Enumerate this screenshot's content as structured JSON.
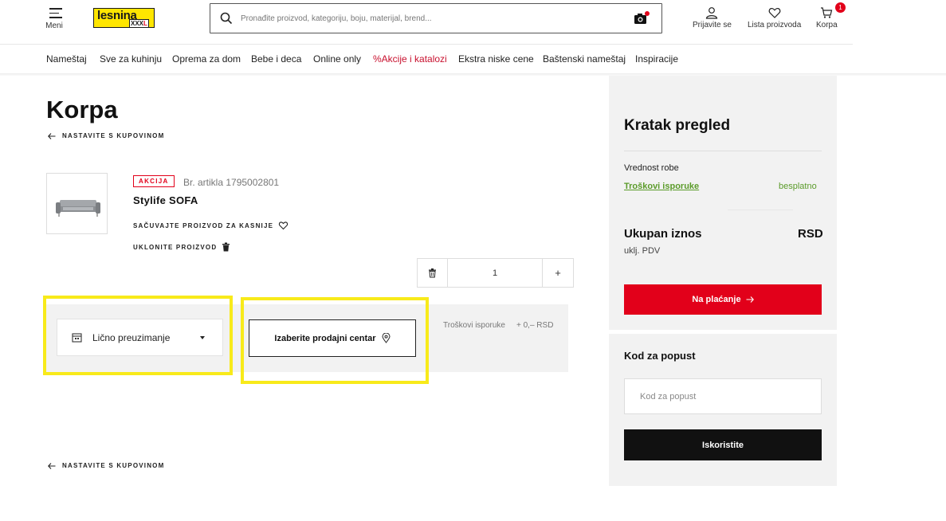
{
  "header": {
    "menu_label": "Meni",
    "logo_text": "lesnina",
    "logo_xxxl": "XXX",
    "logo_l": "L",
    "search_placeholder": "Pronađite proizvod, kategoriju, boju, materijal, brend...",
    "login_label": "Prijavite se",
    "wishlist_label": "Lista proizvoda",
    "cart_label": "Korpa",
    "cart_count": "1"
  },
  "nav": {
    "items": [
      "Nameštaj",
      "Sve za kuhinju",
      "Oprema za dom",
      "Bebe i deca",
      "Online only",
      "%Akcije i katalozi",
      "Ekstra niske cene",
      "Baštenski nameštaj",
      "Inspiracije"
    ]
  },
  "cart": {
    "title": "Korpa",
    "continue_label": "NASTAVITE S KUPOVINOM",
    "item": {
      "badge": "AKCIJA",
      "article_no": "Br. artikla 1795002801",
      "name": "Stylife SOFA",
      "save_label": "SAČUVAJTE PROIZVOD ZA KASNIJE",
      "remove_label": "UKLONITE PROIZVOD",
      "quantity": "1",
      "plus": "+"
    },
    "delivery": {
      "method": "Lično preuzimanje",
      "store_button": "Izaberite prodajni centar",
      "shipping_label": "Troškovi isporuke",
      "shipping_value": "+ 0,– RSD"
    }
  },
  "summary": {
    "title": "Kratak pregled",
    "goods_label": "Vrednost robe",
    "shipping_link": "Troškovi isporuke",
    "shipping_value": "besplatno",
    "total_label": "Ukupan iznos",
    "currency": "RSD",
    "vat_label": "uklj. PDV",
    "checkout_label": "Na plaćanje"
  },
  "discount": {
    "title": "Kod za popust",
    "placeholder": "Kod za popust",
    "apply_label": "Iskoristite"
  },
  "colors": {
    "brand_yellow": "#ffe600",
    "accent_red": "#e2001a",
    "free_green": "#5b9b2a",
    "highlight_yellow": "#f8ea1a"
  }
}
